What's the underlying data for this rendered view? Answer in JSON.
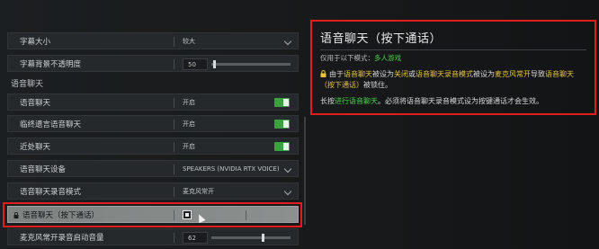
{
  "settings": {
    "rows": [
      {
        "label": "字幕大小",
        "value": "较大"
      },
      {
        "label": "字幕背景不透明度",
        "value": "50"
      },
      {
        "label": "语音聊天",
        "value": "开启"
      },
      {
        "label": "临终遗言语音聊天",
        "value": "开启"
      },
      {
        "label": "近处聊天",
        "value": "开启"
      },
      {
        "label": "语音聊天设备",
        "value": "SPEAKERS (NVIDIA RTX VOICE)"
      },
      {
        "label": "语音聊天录音模式",
        "value": "麦克风常开"
      },
      {
        "label": "语音聊天（按下通话）",
        "value": ""
      },
      {
        "label": "麦克风常开录音启动音量",
        "value": "62"
      }
    ],
    "section_header": "语音聊天"
  },
  "info_panel": {
    "title": "语音聊天（按下通话）",
    "mode_prefix": "仅用于以下模式：",
    "mode_value": "多人游戏",
    "lock_line": {
      "p1": "由于",
      "h1": "语音聊天",
      "p2": "被设为",
      "h2": "关闭",
      "p3": "或",
      "h3": "语音聊天录音模式",
      "p4": "被设为",
      "h4": "麦克风常开",
      "p5": "导致",
      "h5": "语音聊天（按下通话）",
      "p6": "被锁住。"
    },
    "hint_line": {
      "p1": "长按",
      "h1": "进行语音聊天",
      "p2": "。必须将语音聊天录音模式设为按键通话才会生效。"
    }
  },
  "colors": {
    "accent_green": "#4bd04b",
    "accent_yellow": "#e8c43a",
    "highlight_red": "#e01e1e"
  }
}
